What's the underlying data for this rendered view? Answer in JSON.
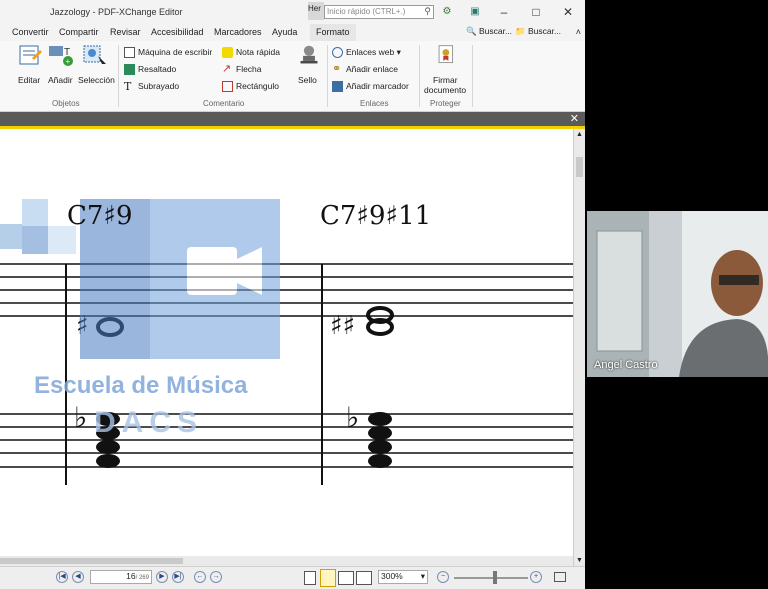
{
  "window": {
    "title": "Jazzology - PDF-XChange Editor",
    "her_label": "Her",
    "search_placeholder": "Inicio rápido (CTRL+.)"
  },
  "menu": {
    "tabs": [
      "Convertir",
      "Compartir",
      "Revisar",
      "Accesibilidad",
      "Marcadores",
      "Ayuda",
      "Formato"
    ],
    "find1": "Buscar...",
    "find2": "Buscar..."
  },
  "ribbon": {
    "objetos": {
      "editar": "Editar",
      "anadir": "Añadir",
      "seleccion": "Selección",
      "group": "Objetos"
    },
    "comentario": {
      "maquina": "Máquina de escribir",
      "resaltado": "Resaltado",
      "subrayado": "Subrayado",
      "nota": "Nota rápida",
      "flecha": "Flecha",
      "rectangulo": "Rectángulo",
      "sello": "Sello",
      "group": "Comentario"
    },
    "enlaces": {
      "web": "Enlaces web",
      "anadir": "Añadir enlace",
      "marcador": "Añadir marcador",
      "group": "Enlaces"
    },
    "proteger": {
      "firmar1": "Firmar",
      "firmar2": "documento",
      "group": "Proteger"
    }
  },
  "document": {
    "chord1": "C7♯9",
    "chord2": "C7♯9♯11",
    "watermark_title": "Escuela de Música",
    "watermark_sub": "DACS"
  },
  "statusbar": {
    "page_current": "16",
    "page_total": "/ 269",
    "zoom": "300%"
  },
  "video": {
    "participant": "Angel Castro"
  }
}
